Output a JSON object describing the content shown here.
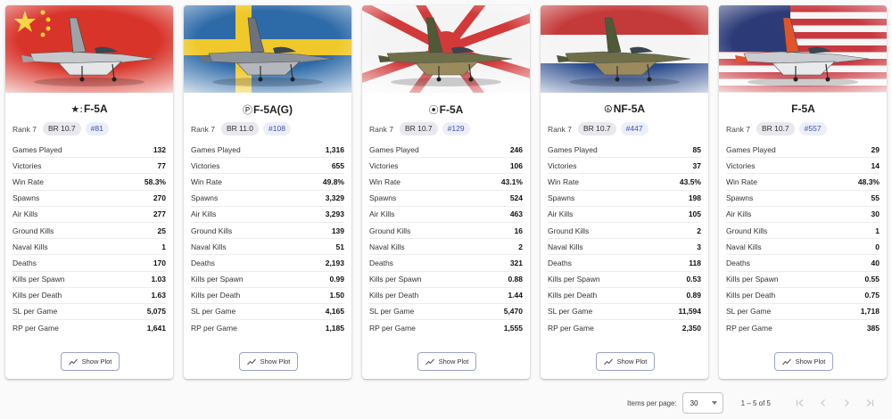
{
  "stat_labels": [
    "Games Played",
    "Victories",
    "Win Rate",
    "Spawns",
    "Air Kills",
    "Ground Kills",
    "Naval Kills",
    "Deaths",
    "Kills per Spawn",
    "Kills per Death",
    "SL per Game",
    "RP per Game"
  ],
  "cards": [
    {
      "nation_icon": "★:",
      "name": "F-5A",
      "rank": "Rank 7",
      "br": "BR 10.7",
      "position": "#81",
      "camo": "silver",
      "flag": "china",
      "show_plot_label": "Show Plot",
      "stats": [
        "132",
        "77",
        "58.3%",
        "270",
        "277",
        "25",
        "1",
        "170",
        "1.03",
        "1.63",
        "5,075",
        "1,641"
      ]
    },
    {
      "nation_icon": "Ⓟ",
      "name": "F-5A(G)",
      "rank": "Rank 7",
      "br": "BR 11.0",
      "position": "#108",
      "camo": "grey",
      "flag": "sweden",
      "show_plot_label": "Show Plot",
      "stats": [
        "1,316",
        "655",
        "49.8%",
        "3,329",
        "3,293",
        "139",
        "51",
        "2,193",
        "0.99",
        "1.50",
        "4,165",
        "1,185"
      ]
    },
    {
      "nation_icon": "⦿",
      "name": "F-5A",
      "rank": "Rank 7",
      "br": "BR 10.7",
      "position": "#129",
      "camo": "green",
      "flag": "japan",
      "show_plot_label": "Show Plot",
      "stats": [
        "246",
        "106",
        "43.1%",
        "524",
        "463",
        "16",
        "2",
        "321",
        "0.88",
        "1.44",
        "5,470",
        "1,555"
      ]
    },
    {
      "nation_icon": "☮",
      "name": "NF-5A",
      "rank": "Rank 7",
      "br": "BR 10.7",
      "position": "#447",
      "camo": "green",
      "flag": "netherlands",
      "show_plot_label": "Show Plot",
      "stats": [
        "85",
        "37",
        "43.5%",
        "198",
        "105",
        "2",
        "3",
        "118",
        "0.53",
        "0.89",
        "11,594",
        "2,350"
      ]
    },
    {
      "nation_icon": "",
      "name": "F-5A",
      "rank": "Rank 7",
      "br": "BR 10.7",
      "position": "#557",
      "camo": "silver-orange",
      "flag": "usa",
      "show_plot_label": "Show Plot",
      "stats": [
        "29",
        "14",
        "48.3%",
        "55",
        "30",
        "1",
        "0",
        "40",
        "0.55",
        "0.75",
        "1,718",
        "385"
      ]
    }
  ],
  "pagination": {
    "items_per_page_label": "Items per page:",
    "items_per_page": "30",
    "range": "1 – 5 of 5"
  },
  "colors": {
    "accent": "#3f51b5",
    "chip_bg": "#e8e8ee",
    "border": "#c4c4c4"
  }
}
